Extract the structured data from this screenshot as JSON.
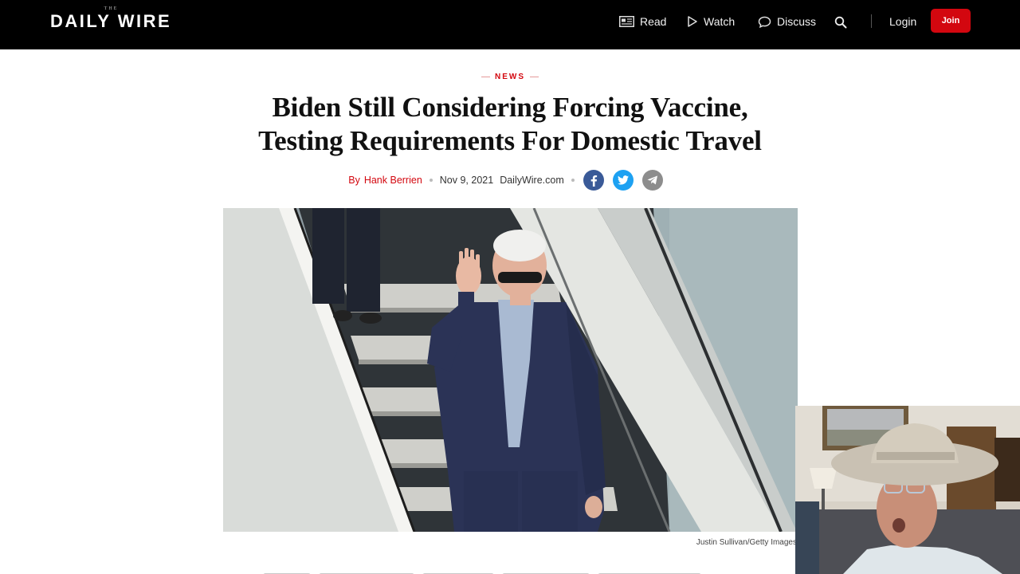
{
  "header": {
    "logo_small": "THE",
    "logo": "DAILY WIRE",
    "nav": {
      "read": "Read",
      "watch": "Watch",
      "discuss": "Discuss",
      "login": "Login",
      "join": "Join"
    }
  },
  "article": {
    "category": "NEWS",
    "headline_line1": "Biden Still Considering Forcing Vaccine,",
    "headline_line2": "Testing Requirements For Domestic Travel",
    "by_prefix": "By",
    "author": "Hank Berrien",
    "date": "Nov 9, 2021",
    "source": "DailyWire.com",
    "share": [
      "facebook-icon",
      "twitter-icon",
      "telegram-icon"
    ],
    "photo_credit": "Justin Sullivan/Getty Images"
  },
  "colors": {
    "brand_red": "#d3070f",
    "header_bg": "#000000",
    "facebook": "#3a5a98",
    "twitter": "#1da1f2",
    "telegram": "#8d8d8d"
  }
}
